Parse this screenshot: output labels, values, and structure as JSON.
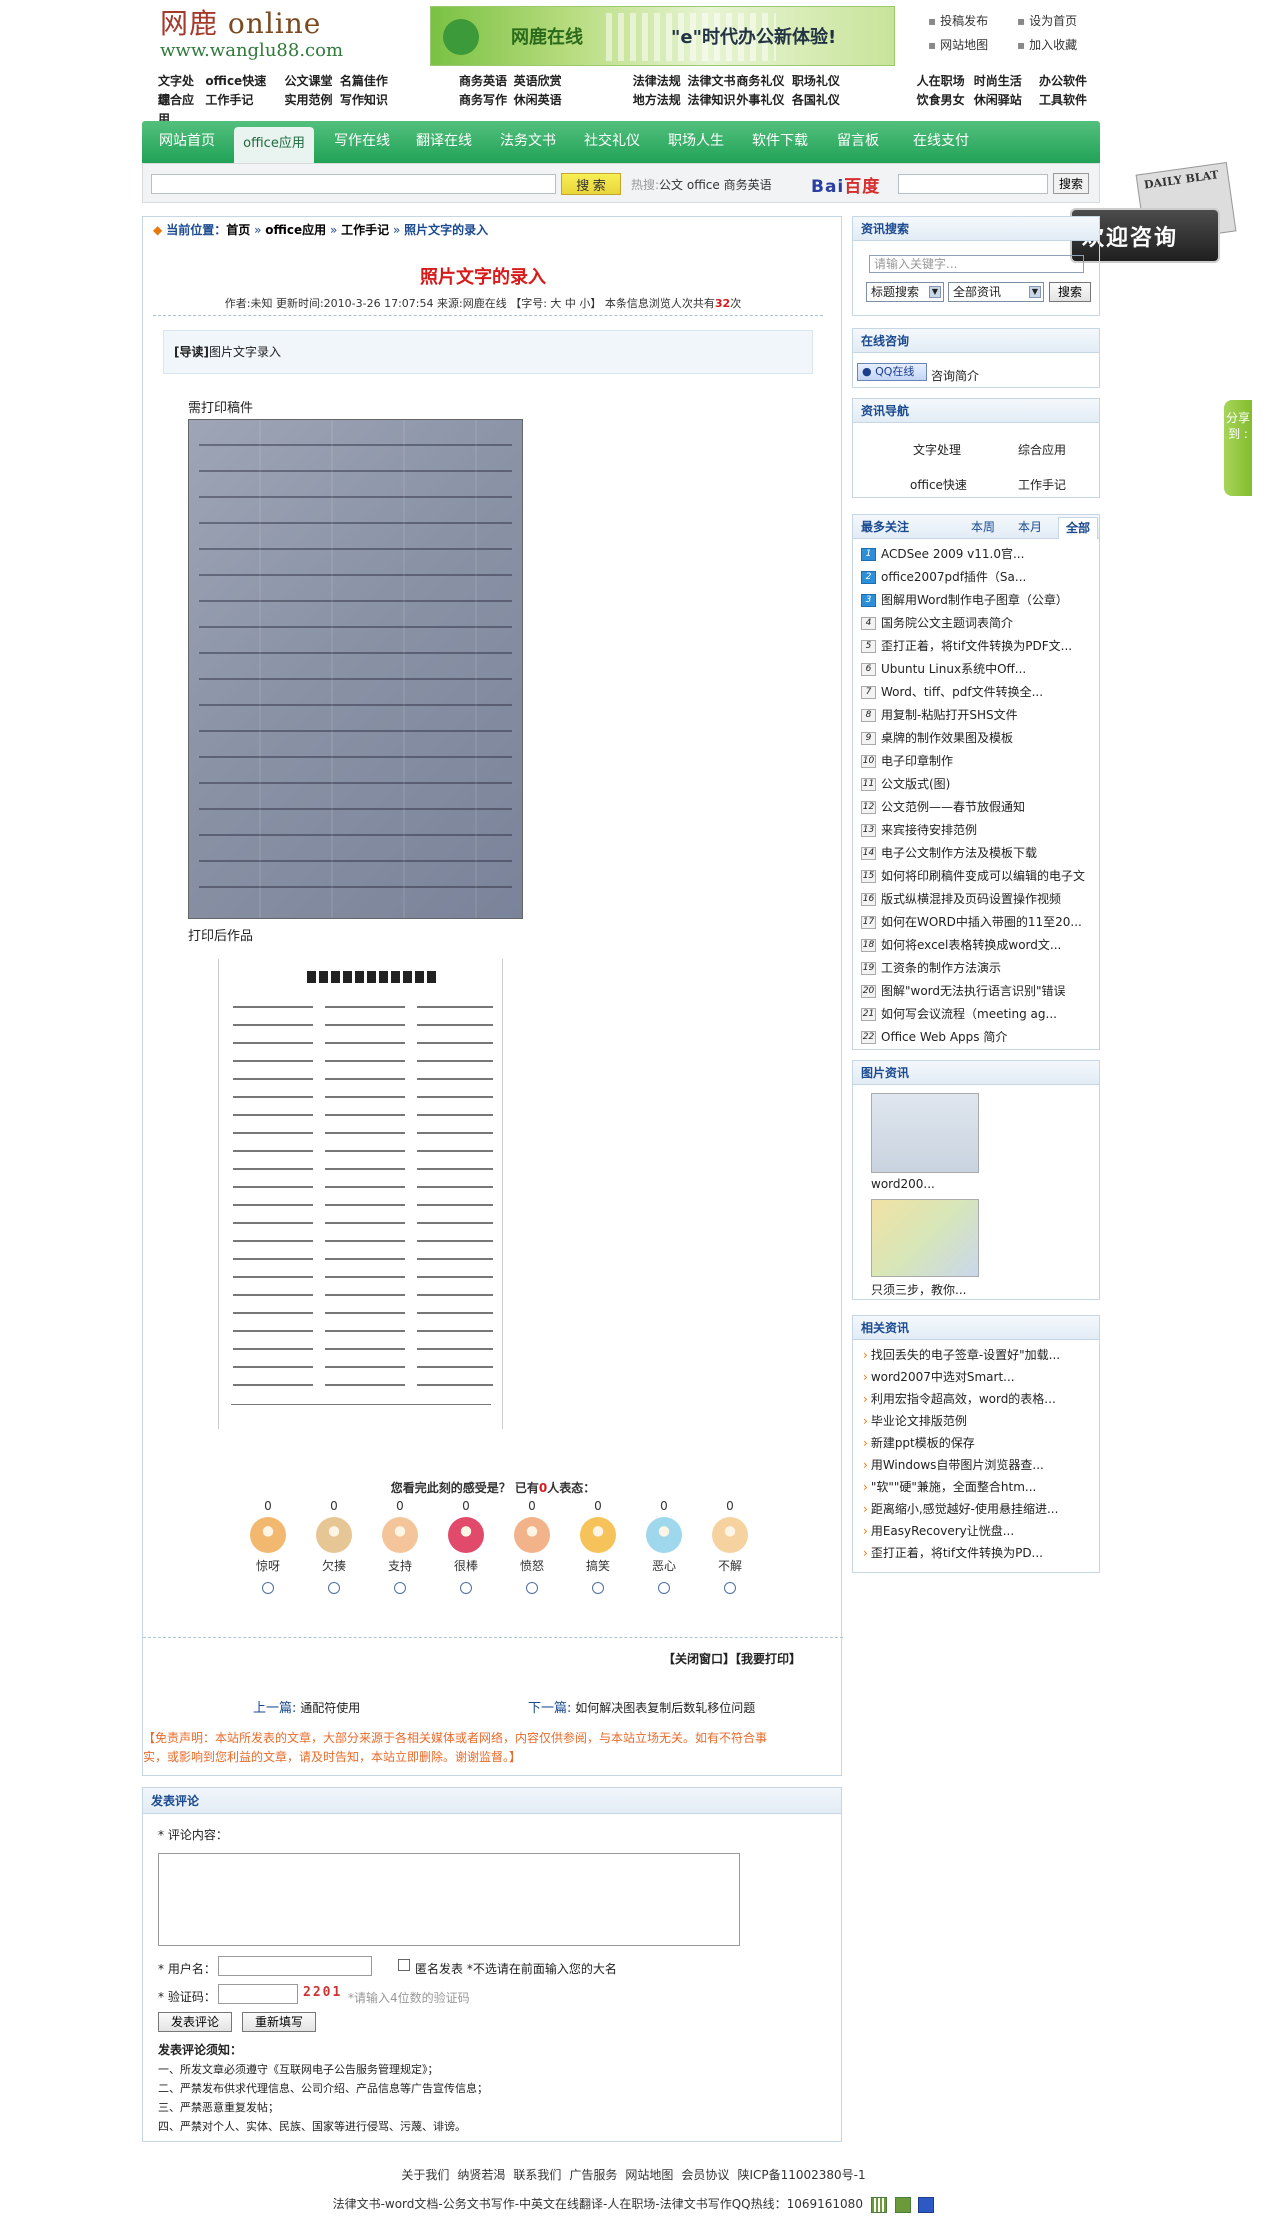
{
  "header": {
    "logo_cn": "网鹿",
    "logo_en": "online",
    "logo_url": "www.wanglu88.com",
    "banner_title": "网鹿在线",
    "banner_slogan": "\"e\"时代办公新体验!",
    "top_links": [
      "投稿发布",
      "设为首页",
      "网站地图",
      "加入收藏"
    ],
    "cat_row1": [
      "文字处理",
      "office快速",
      "公文课堂",
      "名篇佳作",
      "商务英语",
      "英语欣赏",
      "法律法规",
      "法律文书",
      "商务礼仪",
      "职场礼仪",
      "人在职场",
      "时尚生活",
      "办公软件"
    ],
    "cat_row2": [
      "综合应用",
      "工作手记",
      "实用范例",
      "写作知识",
      "商务写作",
      "休闲英语",
      "地方法规",
      "法律知识",
      "外事礼仪",
      "各国礼仪",
      "饮食男女",
      "休闲驿站",
      "工具软件"
    ]
  },
  "nav": {
    "items": [
      "网站首页",
      "office应用",
      "写作在线",
      "翻译在线",
      "法务文书",
      "社交礼仪",
      "职场人生",
      "软件下载",
      "留言板",
      "在线支付"
    ],
    "active_index": 1
  },
  "search": {
    "button": "搜 索",
    "hot_label": "热搜:",
    "hot_terms": "公文 office 商务英语",
    "baidu_logo": "Bai",
    "baidu_logo2": "百度",
    "baidu_button": "搜索"
  },
  "consult_ad": {
    "paper": "DAILY BLAT",
    "text": "欢迎咨询"
  },
  "share_tab": "分享到 :",
  "article": {
    "breadcrumb_label": "当前位置：",
    "breadcrumb": [
      "首页",
      "office应用",
      "工作手记",
      "照片文字的录入"
    ],
    "title": "照片文字的录入",
    "meta_prefix": "作者:未知 更新时间:2010-3-26 17:07:54 来源:网鹿在线 【字号: 大 中 小】 本条信息浏览人次共有",
    "view_count": "32",
    "meta_suffix": "次",
    "lead_label": "[导读]",
    "lead_text": "图片文字录入",
    "caption1": "需打印稿件",
    "caption2": "打印后作品",
    "mood_question_a": "您看完此刻的感受是？ 已有",
    "mood_count": "0",
    "mood_question_b": "人表态：",
    "moods": [
      {
        "label": "惊呀",
        "count": "0",
        "color": "#f3b870"
      },
      {
        "label": "欠揍",
        "count": "0",
        "color": "#e6c694"
      },
      {
        "label": "支持",
        "count": "0",
        "color": "#f4c49a"
      },
      {
        "label": "很棒",
        "count": "0",
        "color": "#e14a6a"
      },
      {
        "label": "愤怒",
        "count": "0",
        "color": "#f2b38a"
      },
      {
        "label": "搞笑",
        "count": "0",
        "color": "#f6c25a"
      },
      {
        "label": "恶心",
        "count": "0",
        "color": "#9fd7ec"
      },
      {
        "label": "不解",
        "count": "0",
        "color": "#f6d2a0"
      }
    ],
    "close_print": "【关闭窗口】【我要打印】",
    "prev_label": "上一篇:",
    "prev_title": "通配符使用",
    "next_label": "下一篇:",
    "next_title": "如何解决图表复制后数轧移位问题",
    "disclaimer": "【免责声明：本站所发表的文章，大部分来源于各相关媒体或者网络，内容仅供参阅，与本站立场无关。如有不符合事实，或影响到您利益的文章，请及时告知，本站立即删除。谢谢监督。】"
  },
  "comment": {
    "header": "发表评论",
    "content_label": "* 评论内容：",
    "user_label": "* 用户名：",
    "anon_label": "匿名发表 *不选请在前面输入您的大名",
    "captcha_label": "* 验证码：",
    "captcha_code": "2201",
    "captcha_hint": "*请输入4位数的验证码",
    "submit": "发表评论",
    "reset": "重新填写",
    "rules_title": "发表评论须知：",
    "rules": [
      "一、所发文章必须遵守《互联网电子公告服务管理规定》；",
      "二、严禁发布供求代理信息、公司介绍、产品信息等广告宣传信息；",
      "三、严禁恶意重复发帖；",
      "四、严禁对个人、实体、民族、国家等进行侵骂、污蔑、诽谤。"
    ]
  },
  "sidebar": {
    "search_title": "资讯搜索",
    "search_placeholder": "请输入关键字...",
    "sel1": "标题搜索",
    "sel2": "全部资讯",
    "search_button": "搜索",
    "consult_title": "在线咨询",
    "qq_label": "QQ在线",
    "consult_intro": "咨询简介",
    "guide_title": "资讯导航",
    "guide": [
      "文字处理",
      "综合应用",
      "office快速",
      "工作手记"
    ],
    "hot_title": "最多关注",
    "hot_tabs": [
      "本周",
      "本月",
      "全部"
    ],
    "hot_items": [
      "ACDSee 2009 v11.0官...",
      "office2007pdf插件（Sa...",
      "图解用Word制作电子图章（公章）",
      "国务院公文主题词表简介",
      "歪打正着，将tif文件转换为PDF文...",
      "Ubuntu Linux系统中Off...",
      "Word、tiff、pdf文件转换全...",
      "用复制-粘贴打开SHS文件",
      "桌牌的制作效果图及模板",
      "电子印章制作",
      "公文版式(图)",
      "公文范例——春节放假通知",
      "来宾接待安排范例",
      "电子公文制作方法及模板下载",
      "如何将印刷稿件变成可以编辑的电子文",
      "版式纵横混排及页码设置操作视频",
      "如何在WORD中插入带圈的11至20...",
      "如何将excel表格转换成word文...",
      "工资条的制作方法演示",
      "图解\"word无法执行语言识别\"错误",
      "如何写会议流程（meeting ag...",
      "Office Web Apps 简介"
    ],
    "pic_title": "图片资讯",
    "pics": [
      "word200...",
      "只须三步，教你..."
    ],
    "related_title": "相关资讯",
    "related": [
      "找回丢失的电子签章-设置好\"加载...",
      "word2007中选对Smart...",
      "利用宏指令超高效，word的表格...",
      "毕业论文排版范例",
      "新建ppt模板的保存",
      "用Windows自带图片浏览器查...",
      "\"软\"\"硬\"兼施，全面整合htm...",
      "距离缩小,感觉越好-使用悬挂缩进...",
      "用EasyRecovery让恍盘...",
      "歪打正着，将tif文件转换为PD..."
    ]
  },
  "footer": {
    "links": [
      "关于我们",
      "纳贤若渴",
      "联系我们",
      "广告服务",
      "网站地图",
      "会员协议",
      "陕ICP备11002380号-1"
    ],
    "line2": "法律文书-word文档-公务文书写作-中英文在线翻译-人在职场-法律文书写作QQ热线：1069161080"
  }
}
